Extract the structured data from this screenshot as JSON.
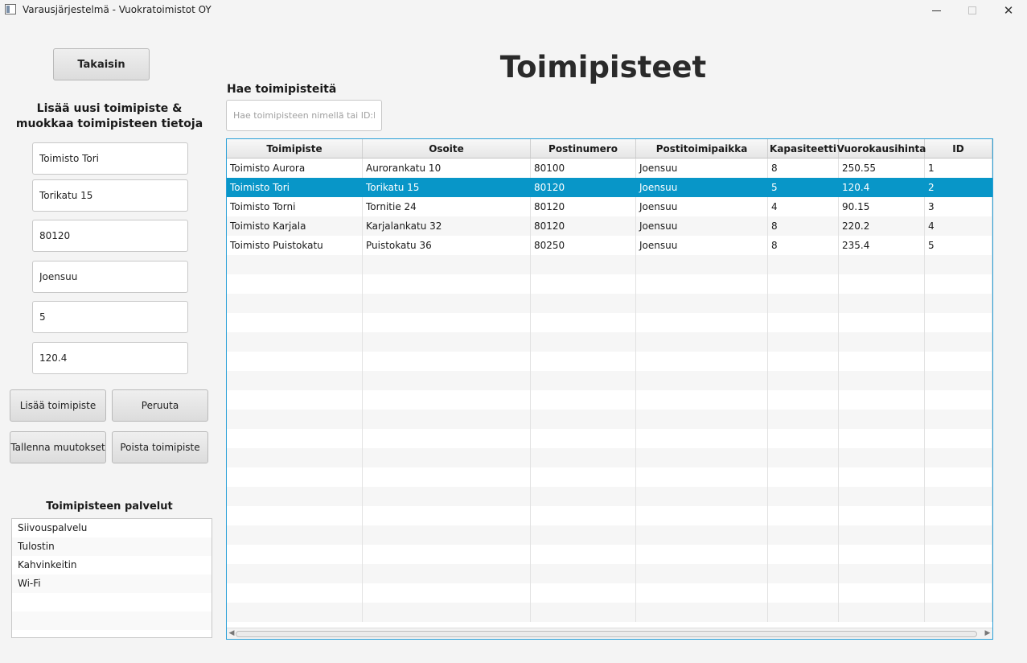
{
  "window": {
    "title": "Varausjärjestelmä - Vuokratoimistot OY",
    "close_glyph": "✕"
  },
  "back_label": "Takaisin",
  "form": {
    "heading_line1": "Lisää uusi toimipiste &",
    "heading_line2": "muokkaa toimipisteen tietoja",
    "name": "Toimisto Tori",
    "address": "Torikatu 15",
    "postal_code": "80120",
    "city": "Joensuu",
    "capacity": "5",
    "daily_price": "120.4"
  },
  "buttons": {
    "add": "Lisää toimipiste",
    "cancel": "Peruuta",
    "save": "Tallenna muutokset",
    "delete": "Poista toimipiste"
  },
  "services": {
    "heading": "Toimipisteen palvelut",
    "items": [
      "Siivouspalvelu",
      "Tulostin",
      "Kahvinkeitin",
      "Wi-Fi"
    ]
  },
  "page_title": "Toimipisteet",
  "search": {
    "label": "Hae toimipisteitä",
    "placeholder": "Hae toimipisteen nimellä tai ID:llä"
  },
  "table": {
    "columns": [
      "Toimipiste",
      "Osoite",
      "Postinumero",
      "Postitoimipaikka",
      "Kapasiteetti",
      "Vuorokausihinta",
      "ID"
    ],
    "rows": [
      [
        "Toimisto Aurora",
        "Aurorankatu 10",
        "80100",
        "Joensuu",
        "8",
        "250.55",
        "1"
      ],
      [
        "Toimisto Tori",
        "Torikatu 15",
        "80120",
        "Joensuu",
        "5",
        "120.4",
        "2"
      ],
      [
        "Toimisto Torni",
        "Tornitie 24",
        "80120",
        "Joensuu",
        "4",
        "90.15",
        "3"
      ],
      [
        "Toimisto Karjala",
        "Karjalankatu 32",
        "80120",
        "Joensuu",
        "8",
        "220.2",
        "4"
      ],
      [
        "Toimisto Puistokatu",
        "Puistokatu 36",
        "80250",
        "Joensuu",
        "8",
        "235.4",
        "5"
      ]
    ],
    "selected_row": 1,
    "empty_rows": 19
  },
  "colors": {
    "accent": "#0896c8",
    "focus_border": "#2aa0d8"
  }
}
